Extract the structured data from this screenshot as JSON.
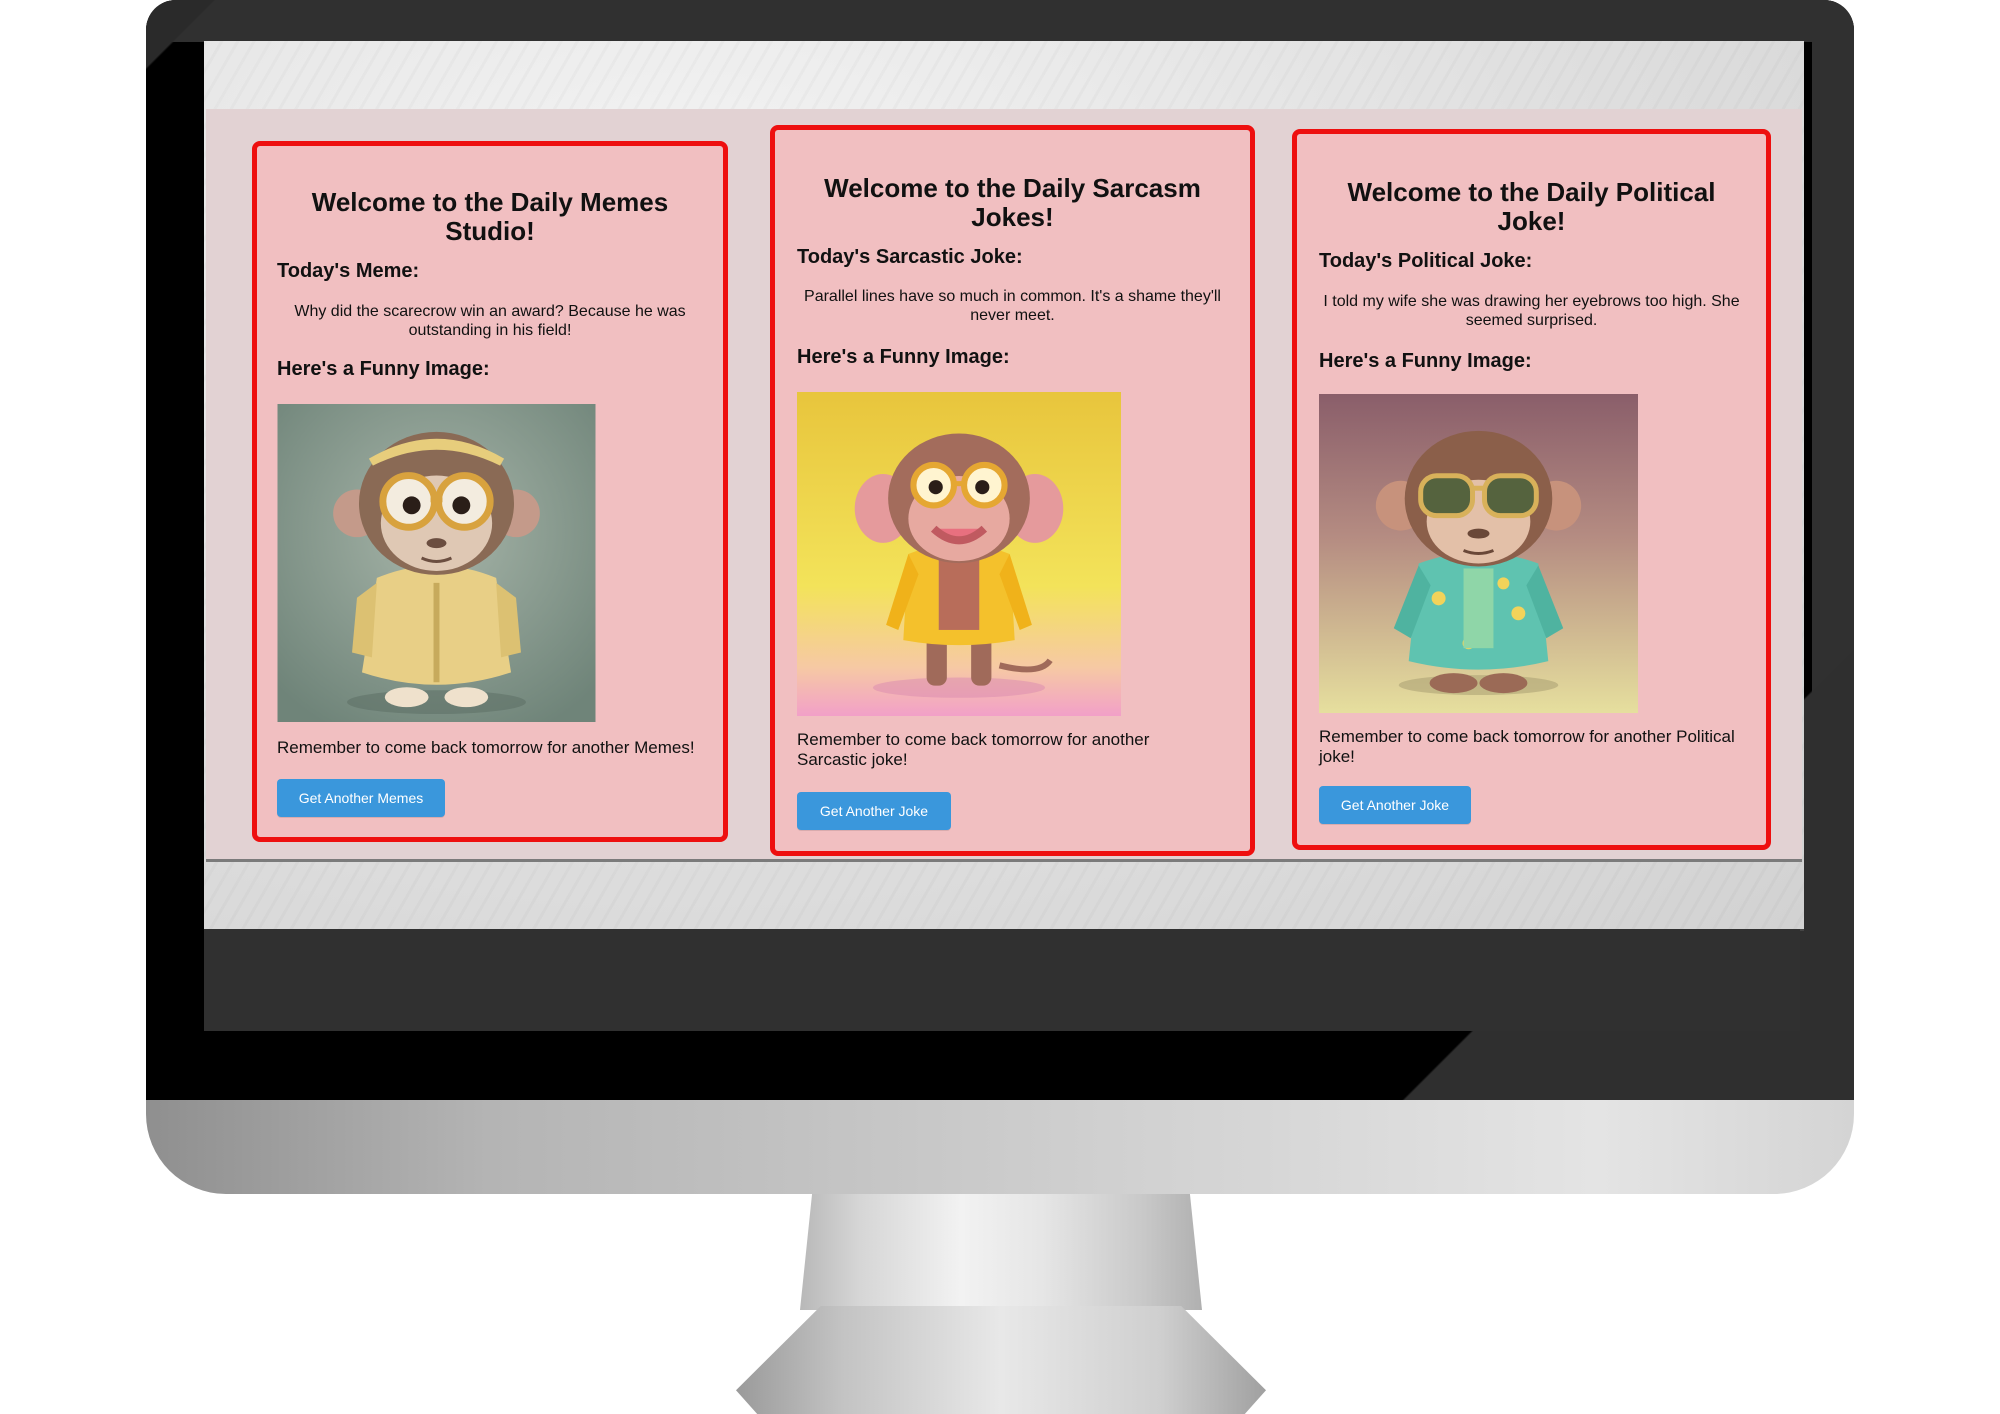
{
  "cards": [
    {
      "title": "Welcome to the Daily Memes Studio!",
      "section_label": "Today's Meme:",
      "joke": "Why did the scarecrow win an award? Because he was outstanding in his field!",
      "image_label": "Here's a Funny Image:",
      "reminder": "Remember to come back tomorrow for another Memes!",
      "button_label": "Get Another Memes"
    },
    {
      "title": "Welcome to the Daily Sarcasm Jokes!",
      "section_label": "Today's Sarcastic Joke:",
      "joke": "Parallel lines have so much in common. It's a shame they'll never meet.",
      "image_label": "Here's a Funny Image:",
      "reminder": "Remember to come back tomorrow for another Sarcastic joke!",
      "button_label": "Get Another Joke"
    },
    {
      "title": "Welcome to the Daily Political Joke!",
      "section_label": "Today's Political Joke:",
      "joke": "I told my wife she was drawing her eyebrows too high. She seemed surprised.",
      "image_label": "Here's a Funny Image:",
      "reminder": "Remember to come back tomorrow for another Political joke!",
      "button_label": "Get Another Joke"
    }
  ],
  "colors": {
    "card_border": "#ee0f0f",
    "card_background": "#f1bfc1",
    "button": "#3a97dc",
    "page_background": "#e2d2d3"
  },
  "icons": {
    "image1": "monkey-in-yellow-hoodie-with-glasses",
    "image2": "monkey-in-yellow-shirt-on-yellow-background",
    "image3": "monkey-in-hawaiian-shirt-with-sunglasses"
  }
}
